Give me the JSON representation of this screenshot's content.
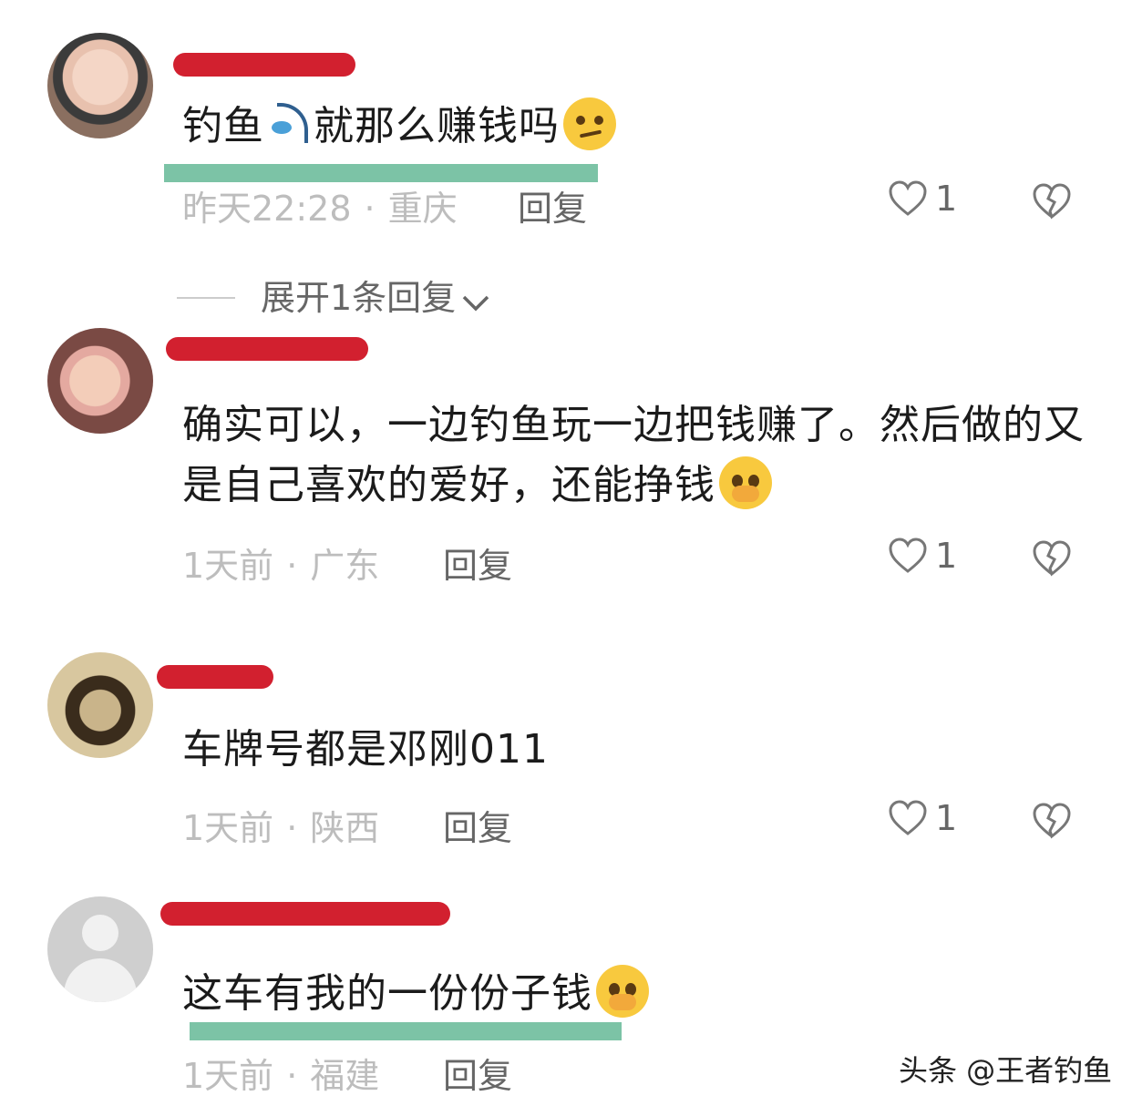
{
  "comments": [
    {
      "text_before": "钓鱼",
      "text_after": "就那么赚钱吗",
      "time": "昨天22:28",
      "location": "重庆",
      "reply_label": "回复",
      "likes": "1",
      "has_underline": true
    },
    {
      "text": "确实可以，一边钓鱼玩一边把钱赚了。然后做的又是自己喜欢的爱好，还能挣钱",
      "time": "1天前",
      "location": "广东",
      "reply_label": "回复",
      "likes": "1"
    },
    {
      "text": "车牌号都是邓刚011",
      "time": "1天前",
      "location": "陕西",
      "reply_label": "回复",
      "likes": "1"
    },
    {
      "text": "这车有我的一份份子钱",
      "time": "1天前",
      "location": "福建",
      "reply_label": "回复",
      "has_underline": true
    }
  ],
  "expand_replies_label": "展开1条回复",
  "separator": "·",
  "watermark": "头条 @王者钓鱼",
  "colors": {
    "redaction": "#d2202f",
    "highlight_underline": "#7cc3a6"
  },
  "icons": [
    "heart-outline-icon",
    "broken-heart-icon",
    "chevron-down-icon",
    "fishing-pole-emoji",
    "smirk-emoji",
    "pleading-hand-over-mouth-emoji"
  ]
}
